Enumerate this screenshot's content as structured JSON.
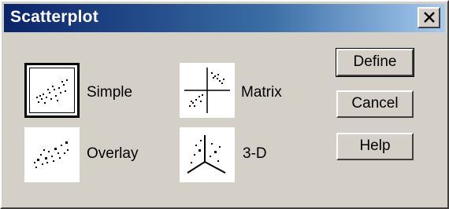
{
  "window": {
    "title": "Scatterplot"
  },
  "options": [
    {
      "id": "simple",
      "label": "Simple",
      "icon": "simple-scatter-icon",
      "selected": true
    },
    {
      "id": "overlay",
      "label": "Overlay",
      "icon": "overlay-scatter-icon",
      "selected": false
    },
    {
      "id": "matrix",
      "label": "Matrix",
      "icon": "matrix-scatter-icon",
      "selected": false
    },
    {
      "id": "3d",
      "label": "3-D",
      "icon": "3d-scatter-icon",
      "selected": false
    }
  ],
  "buttons": {
    "define": "Define",
    "cancel": "Cancel",
    "help": "Help"
  },
  "colors": {
    "titlebar_start": "#0a246a",
    "titlebar_end": "#a6caf0",
    "face": "#d4d0c8"
  }
}
